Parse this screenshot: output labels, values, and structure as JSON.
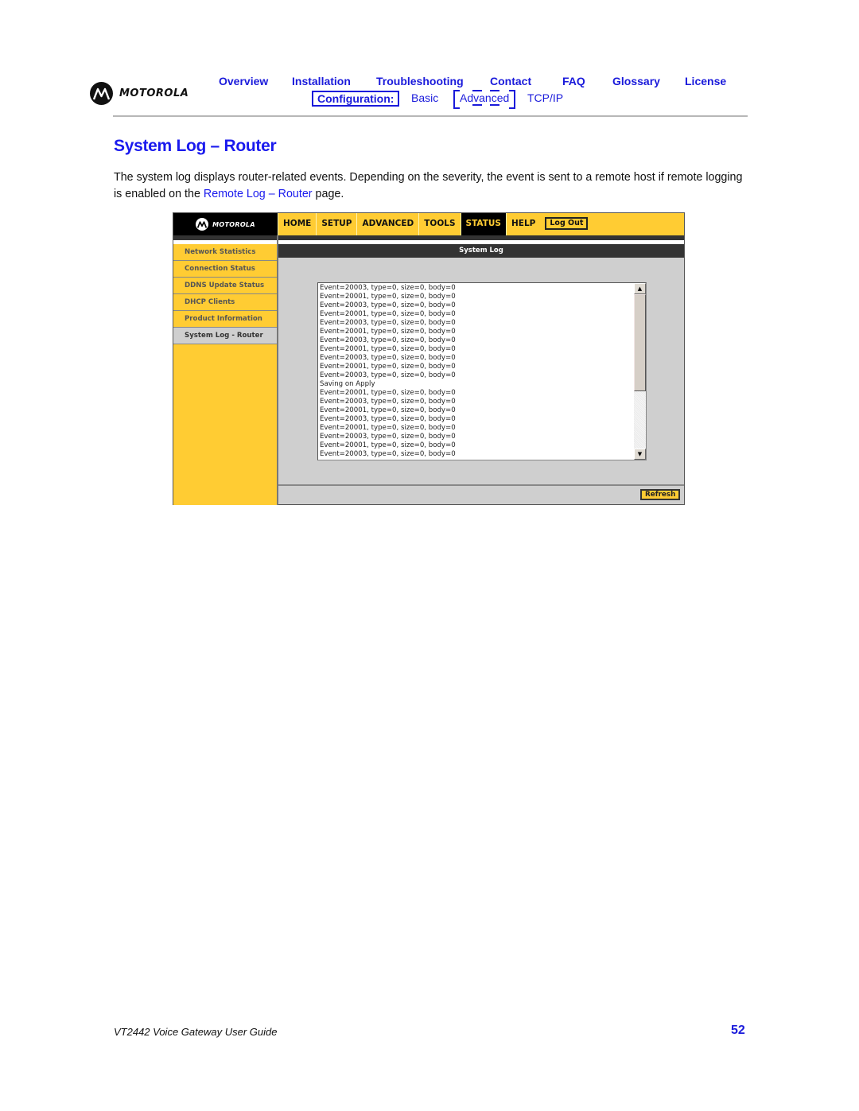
{
  "header": {
    "brand": "MOTOROLA",
    "logo_icon": "motorola-batwing-icon",
    "nav": [
      {
        "label": "Overview"
      },
      {
        "label": "Installation"
      },
      {
        "label": "Troubleshooting"
      },
      {
        "label": "Contact"
      },
      {
        "label": "FAQ"
      },
      {
        "label": "Glossary"
      },
      {
        "label": "License"
      }
    ],
    "subnav": {
      "section_label": "Configuration:",
      "items": [
        {
          "label": "Basic"
        },
        {
          "label": "Advanced",
          "selected": true
        },
        {
          "label": "TCP/IP"
        }
      ]
    }
  },
  "page": {
    "title": "System Log – Router",
    "intro_before_link": "The system log displays router-related events. Depending on the severity, the event is sent to a remote host if remote logging is enabled on the ",
    "intro_link": "Remote Log – Router",
    "intro_after_link": " page."
  },
  "router_ui": {
    "brand": "MOTOROLA",
    "tabs": [
      {
        "label": "HOME",
        "active": false
      },
      {
        "label": "SETUP",
        "active": false
      },
      {
        "label": "ADVANCED",
        "active": false
      },
      {
        "label": "TOOLS",
        "active": false
      },
      {
        "label": "STATUS",
        "active": true
      },
      {
        "label": "HELP",
        "active": false
      }
    ],
    "logout_label": "Log Out",
    "sidebar": [
      {
        "label": "Network Statistics",
        "active": false
      },
      {
        "label": "Connection Status",
        "active": false
      },
      {
        "label": "DDNS Update Status",
        "active": false
      },
      {
        "label": "DHCP Clients",
        "active": false
      },
      {
        "label": "Product Information",
        "active": false
      },
      {
        "label": "System Log - Router",
        "active": true
      }
    ],
    "section_title": "System Log",
    "log_lines": [
      "Event=20003, type=0, size=0, body=0",
      "Event=20001, type=0, size=0, body=0",
      "Event=20003, type=0, size=0, body=0",
      "Event=20001, type=0, size=0, body=0",
      "Event=20003, type=0, size=0, body=0",
      "Event=20001, type=0, size=0, body=0",
      "Event=20003, type=0, size=0, body=0",
      "Event=20001, type=0, size=0, body=0",
      "Event=20003, type=0, size=0, body=0",
      "Event=20001, type=0, size=0, body=0",
      "Event=20003, type=0, size=0, body=0",
      "Saving on Apply",
      "Event=20001, type=0, size=0, body=0",
      "Event=20003, type=0, size=0, body=0",
      "Event=20001, type=0, size=0, body=0",
      "Event=20003, type=0, size=0, body=0",
      "Event=20001, type=0, size=0, body=0",
      "Event=20003, type=0, size=0, body=0",
      "Event=20001, type=0, size=0, body=0",
      "Event=20003, type=0, size=0, body=0"
    ],
    "refresh_label": "Refresh"
  },
  "footer": {
    "guide_title": "VT2442 Voice Gateway User Guide",
    "page_number": "52"
  },
  "colors": {
    "link_blue": "#1a1adb",
    "router_yellow": "#ffcc33",
    "router_dark": "#333333"
  }
}
